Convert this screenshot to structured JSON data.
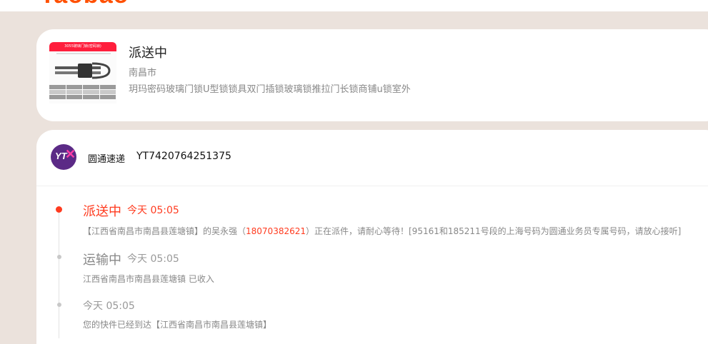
{
  "brand": {
    "logo_text": "Taobao"
  },
  "order": {
    "status": "派送中",
    "city": "南昌市",
    "product_title": "玥玛密码玻璃门锁U型锁锁具双门插锁玻璃锁推拉门长锁商铺u锁室外",
    "thumbnail_banner": "3055玻璃门锁(密码锁)"
  },
  "logistics": {
    "carrier_logo_text": "YT",
    "carrier_name": "圆通速递",
    "tracking_number": "YT7420764251375",
    "events": [
      {
        "status": "派送中",
        "time": "今天 05:05",
        "desc_prefix": "【江西省南昌市南昌县莲塘镇】的吴永强（",
        "phone": "18070382621",
        "desc_suffix": "）正在派件，请耐心等待！[95161和185211号段的上海号码为圆通业务员专属号码，请放心接听]"
      },
      {
        "status": "运输中",
        "time": "今天 05:05",
        "desc": "江西省南昌市南昌县莲塘镇 已收入"
      },
      {
        "status": "",
        "time": "今天 05:05",
        "desc": "您的快件已经到达【江西省南昌市南昌县莲塘镇】"
      }
    ]
  },
  "colors": {
    "accent": "#ff3b1f",
    "brand_orange": "#ff5000",
    "page_bg": "#ebe2dc",
    "carrier_purple": "#5b2a86"
  },
  "icons": [
    "yto-express-logo-icon",
    "timeline-dot-icon",
    "product-thumbnail-image"
  ]
}
